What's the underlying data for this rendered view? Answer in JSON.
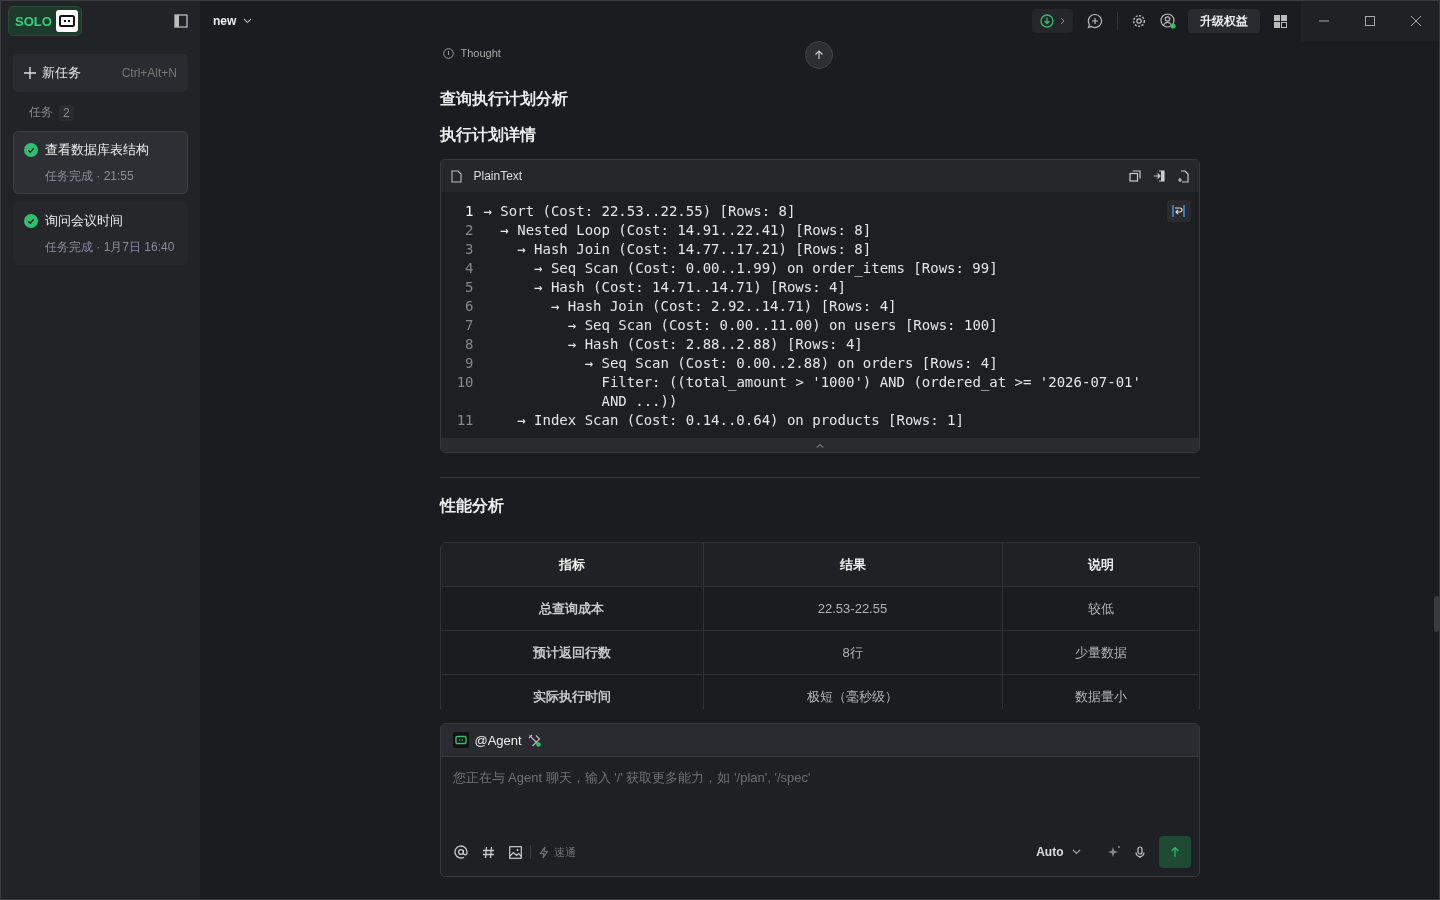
{
  "app": {
    "logo_text": "SOLO",
    "tab_title": "new"
  },
  "toolbar": {
    "upgrade_label": "升级权益"
  },
  "sidebar": {
    "new_task": {
      "label": "新任务",
      "shortcut": "Ctrl+Alt+N"
    },
    "section": {
      "label": "任务",
      "count": "2"
    },
    "tasks": [
      {
        "title": "查看数据库表结构",
        "status": "任务完成 · 21:55",
        "selected": true,
        "done": true
      },
      {
        "title": "询问会议时间",
        "status": "任务完成 · 1月7日 16:40",
        "selected": false,
        "done": true
      }
    ]
  },
  "thought": {
    "label": "Thought"
  },
  "headings": [
    "查询执行计划分析",
    "执行计划详情"
  ],
  "code_block": {
    "language": "PlainText",
    "lines": [
      {
        "number": "1",
        "text": "→ Sort (Cost: 22.53..22.55) [Rows: 8]",
        "current": true
      },
      {
        "number": "2",
        "text": "  → Nested Loop (Cost: 14.91..22.41) [Rows: 8]",
        "current": false
      },
      {
        "number": "3",
        "text": "    → Hash Join (Cost: 14.77..17.21) [Rows: 8]",
        "current": false
      },
      {
        "number": "4",
        "text": "      → Seq Scan (Cost: 0.00..1.99) on order_items [Rows: 99]",
        "current": false
      },
      {
        "number": "5",
        "text": "      → Hash (Cost: 14.71..14.71) [Rows: 4]",
        "current": false
      },
      {
        "number": "6",
        "text": "        → Hash Join (Cost: 2.92..14.71) [Rows: 4]",
        "current": false
      },
      {
        "number": "7",
        "text": "          → Seq Scan (Cost: 0.00..11.00) on users [Rows: 100]",
        "current": false
      },
      {
        "number": "8",
        "text": "          → Hash (Cost: 2.88..2.88) [Rows: 4]",
        "current": false
      },
      {
        "number": "9",
        "text": "            → Seq Scan (Cost: 0.00..2.88) on orders [Rows: 4]",
        "current": false
      },
      {
        "number": "10",
        "text": "              Filter: ((total_amount > '1000') AND (ordered_at >= '2026-07-01' AND ...))",
        "current": false
      },
      {
        "number": "11",
        "text": "    → Index Scan (Cost: 0.14..0.64) on products [Rows: 1]",
        "current": false
      }
    ]
  },
  "section_heading": "性能分析",
  "table": {
    "columns": [
      "指标",
      "结果",
      "说明"
    ],
    "rows": [
      [
        "总查询成本",
        "22.53-22.55",
        "较低"
      ],
      [
        "预计返回行数",
        "8行",
        "少量数据"
      ],
      [
        "实际执行时间",
        "极短（毫秒级）",
        "数据量小"
      ]
    ]
  },
  "composer": {
    "agent": "@Agent",
    "placeholder": "您正在与 Agent 聊天，输入 '/' 获取更多能力，如 '/plan', '/spec'",
    "speed_label": "速通",
    "model": "Auto"
  }
}
